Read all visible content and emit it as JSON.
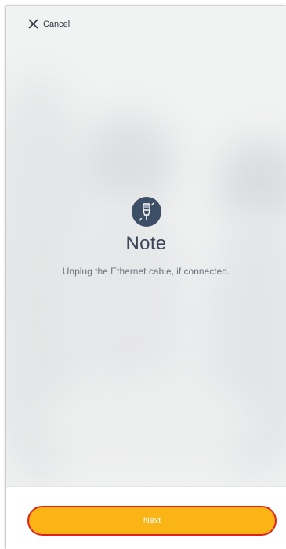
{
  "header": {
    "cancel_label": "Cancel",
    "cancel_icon": "close-icon"
  },
  "main": {
    "icon": "ethernet-cable-icon",
    "title": "Note",
    "message": "Unplug the Ethernet cable, if connected."
  },
  "footer": {
    "next_label": "Next"
  },
  "colors": {
    "accent": "#fbb416",
    "highlight_border": "#e0221b",
    "icon_background": "#3d4f67",
    "title_text": "#3b4658"
  }
}
